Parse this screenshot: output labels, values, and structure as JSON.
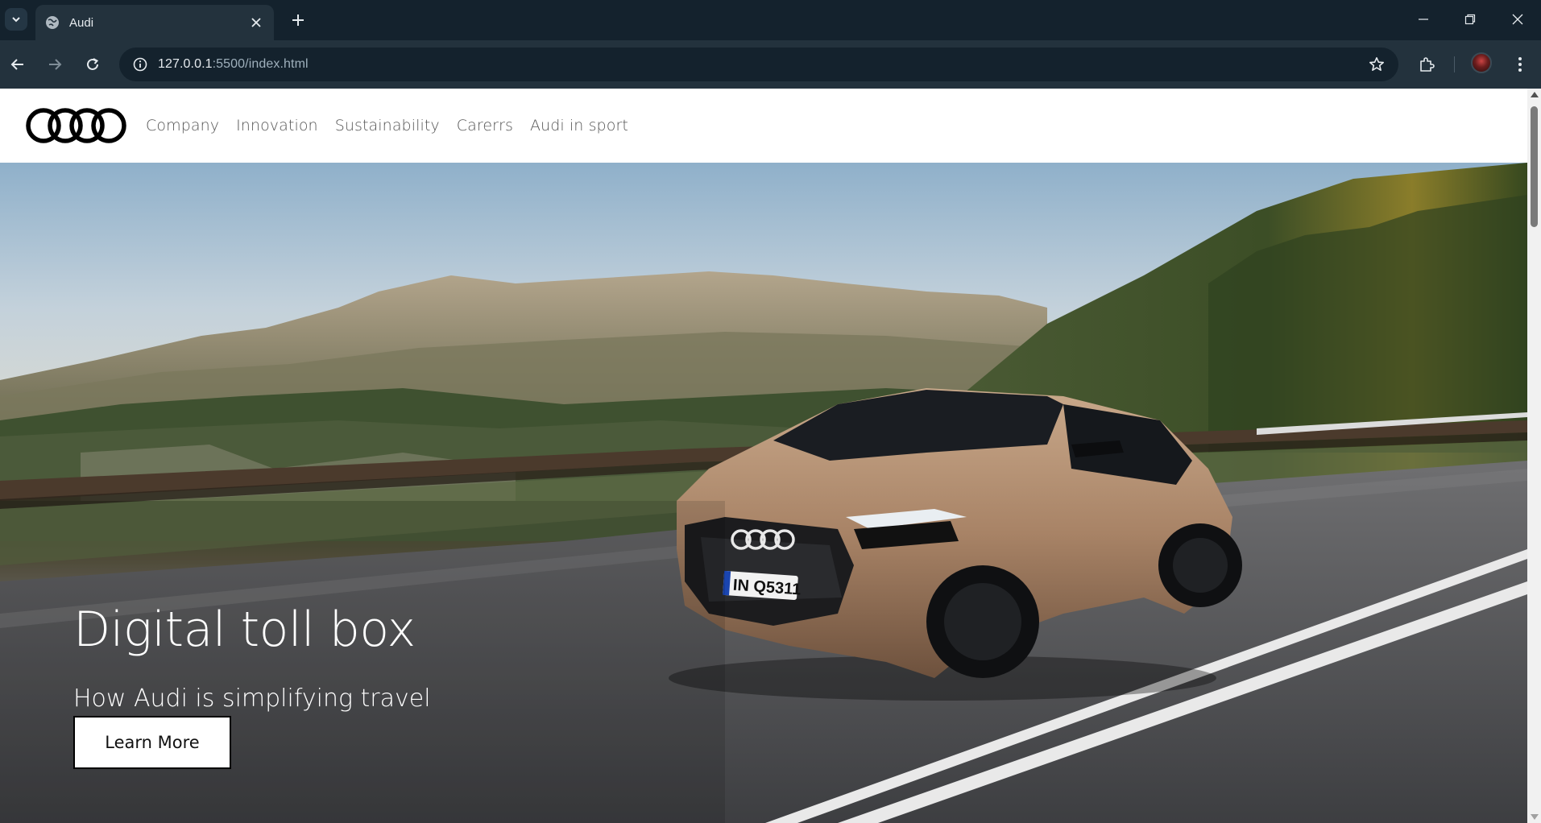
{
  "browser": {
    "tab_title": "Audi",
    "url_host": "127.0.0.1",
    "url_rest": ":5500/index.html",
    "icons": [
      "tab-search-icon",
      "globe-icon",
      "close-icon",
      "plus-icon",
      "minimize-icon",
      "restore-icon",
      "window-close-icon",
      "back-arrow-icon",
      "forward-arrow-icon",
      "reload-icon",
      "info-icon",
      "star-icon",
      "extensions-icon",
      "kebab-menu-icon"
    ]
  },
  "site": {
    "nav": [
      "Company",
      "Innovation",
      "Sustainability",
      "Carerrs",
      "Audi in sport"
    ]
  },
  "hero": {
    "title": "Digital toll box",
    "subtitle": "How Audi is simplifying travel",
    "button_label": "Learn More",
    "license_plate": "IN Q5311"
  }
}
